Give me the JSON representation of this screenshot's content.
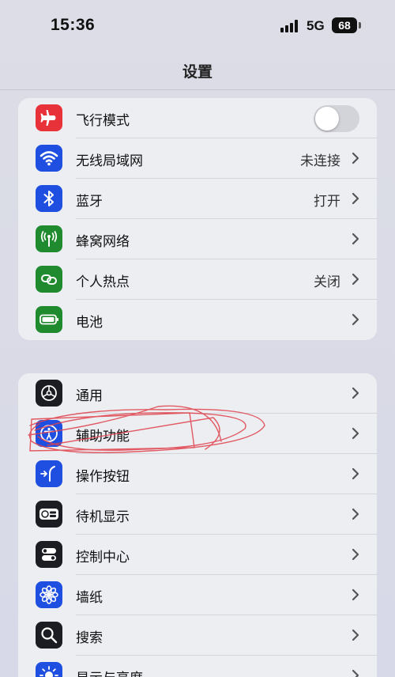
{
  "status": {
    "time": "15:36",
    "network": "5G",
    "battery": "68"
  },
  "header": {
    "title": "设置"
  },
  "group1": [
    {
      "label": "飞行模式",
      "value": "",
      "icon": "airplane-icon",
      "color": "#e8323a",
      "control": "toggle"
    },
    {
      "label": "无线局域网",
      "value": "未连接",
      "icon": "wifi-icon",
      "color": "#1f4fe0",
      "control": "chevron"
    },
    {
      "label": "蓝牙",
      "value": "打开",
      "icon": "bluetooth-icon",
      "color": "#1f4fe0",
      "control": "chevron"
    },
    {
      "label": "蜂窝网络",
      "value": "",
      "icon": "cellular-icon",
      "color": "#1f8a2e",
      "control": "chevron"
    },
    {
      "label": "个人热点",
      "value": "关闭",
      "icon": "hotspot-icon",
      "color": "#1f8a2e",
      "control": "chevron"
    },
    {
      "label": "电池",
      "value": "",
      "icon": "battery-icon",
      "color": "#1f8a2e",
      "control": "chevron"
    }
  ],
  "group2": [
    {
      "label": "通用",
      "icon": "gear-icon",
      "color": "#1c1d22"
    },
    {
      "label": "辅助功能",
      "icon": "accessibility-icon",
      "color": "#1f4fe0"
    },
    {
      "label": "操作按钮",
      "icon": "action-button-icon",
      "color": "#1f4fe0"
    },
    {
      "label": "待机显示",
      "icon": "standby-icon",
      "color": "#1c1d22"
    },
    {
      "label": "控制中心",
      "icon": "control-center-icon",
      "color": "#1c1d22"
    },
    {
      "label": "墙纸",
      "icon": "wallpaper-icon",
      "color": "#1f4fe0"
    },
    {
      "label": "搜索",
      "icon": "search-icon",
      "color": "#1c1d22"
    },
    {
      "label": "显示与亮度",
      "icon": "brightness-icon",
      "color": "#1f4fe0"
    }
  ],
  "annotation": {
    "type": "red-scribble",
    "color": "#e0404a"
  }
}
